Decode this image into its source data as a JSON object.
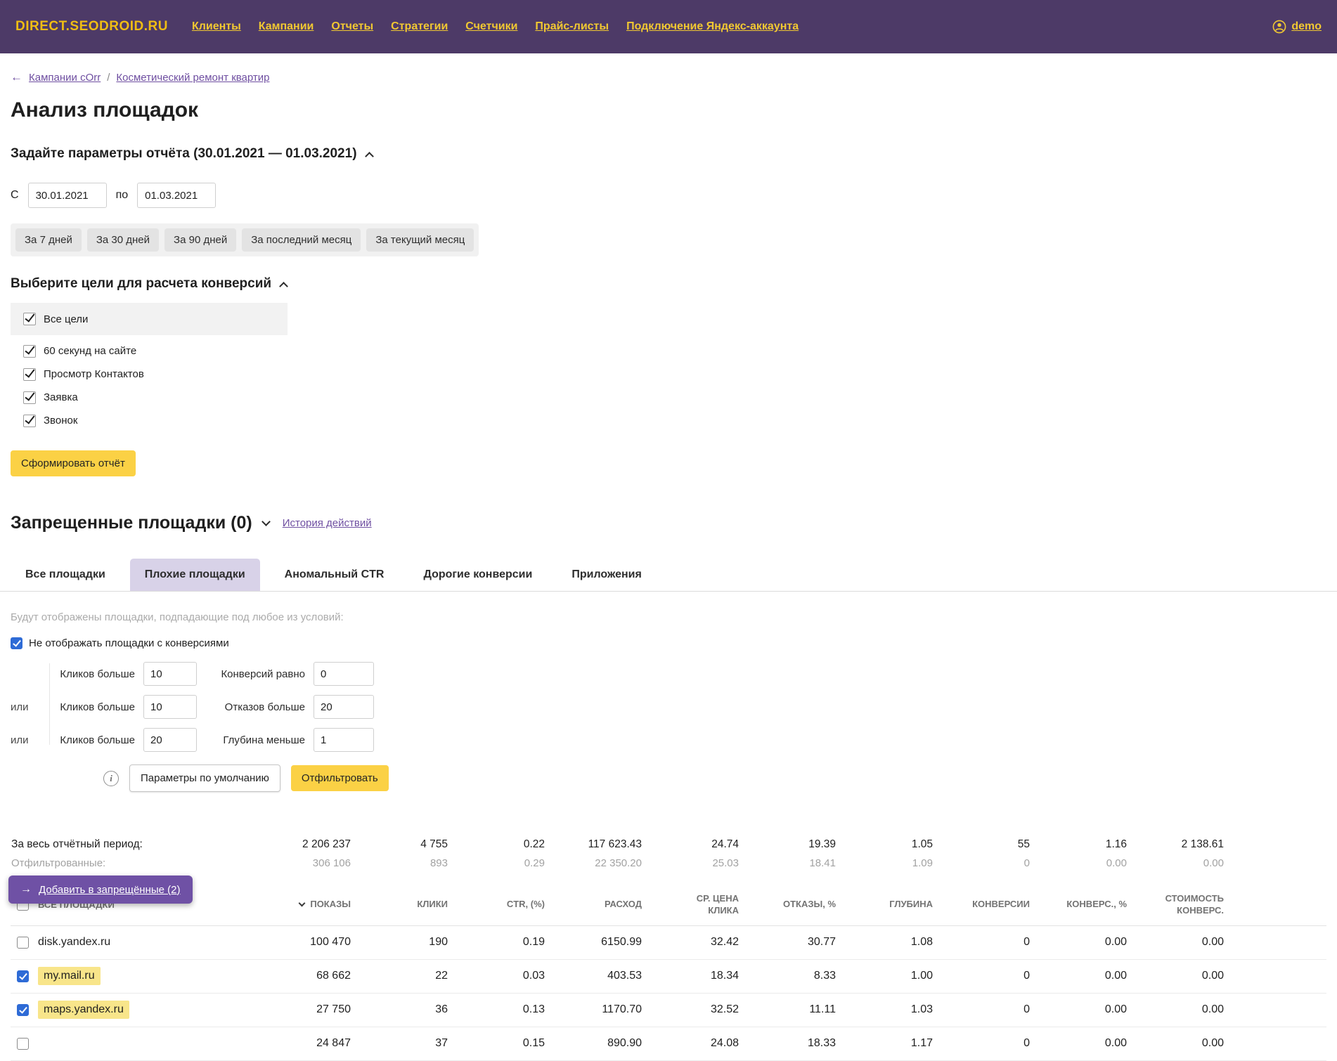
{
  "topbar": {
    "logo": "DIRECT.SEODROID.RU",
    "nav": [
      {
        "label": "Клиенты"
      },
      {
        "label": "Кампании"
      },
      {
        "label": "Отчеты"
      },
      {
        "label": "Стратегии"
      },
      {
        "label": "Счетчики"
      },
      {
        "label": "Прайс-листы"
      },
      {
        "label": "Подключение Яндекс-аккаунта"
      }
    ],
    "user_label": "demo"
  },
  "breadcrumb": {
    "back_arrow": "←",
    "back_label": "Кампании сОrr",
    "separator": "/",
    "current": "Косметический ремонт квартир"
  },
  "page": {
    "title": "Анализ площадок"
  },
  "report_params": {
    "title": "Задайте параметры отчёта (30.01.2021 — 01.03.2021)",
    "from_label": "С",
    "from_value": "30.01.2021",
    "to_label": "по",
    "to_value": "01.03.2021",
    "quick_ranges": [
      {
        "label": "За 7 дней"
      },
      {
        "label": "За 30 дней"
      },
      {
        "label": "За 90 дней"
      },
      {
        "label": "За последний месяц"
      },
      {
        "label": "За текущий месяц"
      }
    ],
    "goals_title": "Выберите цели для расчета конверсий",
    "goals": [
      {
        "label": "Все цели",
        "checked": true
      },
      {
        "label": "60 секунд на сайте",
        "checked": true
      },
      {
        "label": "Просмотр Контактов",
        "checked": true
      },
      {
        "label": "Заявка",
        "checked": true
      },
      {
        "label": "Звонок",
        "checked": true
      }
    ],
    "submit_label": "Сформировать отчёт"
  },
  "banned_section": {
    "title": "Запрещенные площадки (0)",
    "history_link": "История действий"
  },
  "tabs": [
    {
      "label": "Все площадки",
      "active": false
    },
    {
      "label": "Плохие площадки",
      "active": true
    },
    {
      "label": "Аномальный CTR",
      "active": false
    },
    {
      "label": "Дорогие конверсии",
      "active": false
    },
    {
      "label": "Приложения",
      "active": false
    }
  ],
  "filters": {
    "note": "Будут отображены площадки, подпадающие под любое из условий:",
    "hide_conversions": {
      "label": "Не отображать площадки с конверсиями",
      "checked": true
    },
    "or_label": "или",
    "conditions": [
      {
        "left_label": "Кликов больше",
        "left_value": "10",
        "right_label": "Конверсий равно",
        "right_value": "0"
      },
      {
        "left_label": "Кликов больше",
        "left_value": "10",
        "right_label": "Отказов больше",
        "right_value": "20"
      },
      {
        "left_label": "Кликов больше",
        "left_value": "20",
        "right_label": "Глубина меньше",
        "right_value": "1"
      }
    ],
    "defaults_button": "Параметры по умолчанию",
    "filter_button": "Отфильтровать"
  },
  "summary": {
    "total": {
      "label": "За весь отчётный период:",
      "values": [
        "2 206 237",
        "4 755",
        "0.22",
        "117 623.43",
        "24.74",
        "19.39",
        "1.05",
        "55",
        "1.16",
        "2 138.61"
      ]
    },
    "filtered": {
      "label": "Отфильтрованные:",
      "values": [
        "306 106",
        "893",
        "0.29",
        "22 350.20",
        "25.03",
        "18.41",
        "1.09",
        "0",
        "0.00",
        "0.00"
      ]
    }
  },
  "table": {
    "headers": {
      "site": "ВСЕ ПЛОЩАДКИ",
      "cols": [
        "ПОКАЗЫ",
        "КЛИКИ",
        "CTR, (%)",
        "РАСХОД",
        "СР. ЦЕНА\nКЛИКА",
        "ОТКАЗЫ, %",
        "ГЛУБИНА",
        "КОНВЕРСИИ",
        "КОНВЕРС., %",
        "СТОИМОСТЬ\nКОНВЕРС."
      ]
    },
    "rows": [
      {
        "checked": false,
        "site": "disk.yandex.ru",
        "highlighted": false,
        "values": [
          "100 470",
          "190",
          "0.19",
          "6150.99",
          "32.42",
          "30.77",
          "1.08",
          "0",
          "0.00",
          "0.00"
        ]
      },
      {
        "checked": true,
        "site": "my.mail.ru",
        "highlighted": true,
        "values": [
          "68 662",
          "22",
          "0.03",
          "403.53",
          "18.34",
          "8.33",
          "1.00",
          "0",
          "0.00",
          "0.00"
        ]
      },
      {
        "checked": true,
        "site": "maps.yandex.ru",
        "highlighted": true,
        "values": [
          "27 750",
          "36",
          "0.13",
          "1170.70",
          "32.52",
          "11.11",
          "1.03",
          "0",
          "0.00",
          "0.00"
        ]
      },
      {
        "checked": false,
        "site": "",
        "highlighted": false,
        "values": [
          "24 847",
          "37",
          "0.15",
          "890.90",
          "24.08",
          "18.33",
          "1.17",
          "0",
          "0.00",
          "0.00"
        ]
      }
    ]
  },
  "floating_action": {
    "arrow": "→",
    "label": "Добавить в запрещённые (2)"
  },
  "colors": {
    "topbar_bg": "#4d3a67",
    "accent_yellow": "#f1c832",
    "button_yellow": "#fbd145",
    "link_purple": "#6f4fa1",
    "active_tab_bg": "#d8d2e8",
    "highlight_yellow": "#f8e58a",
    "floating_bg": "#6f51a5"
  }
}
